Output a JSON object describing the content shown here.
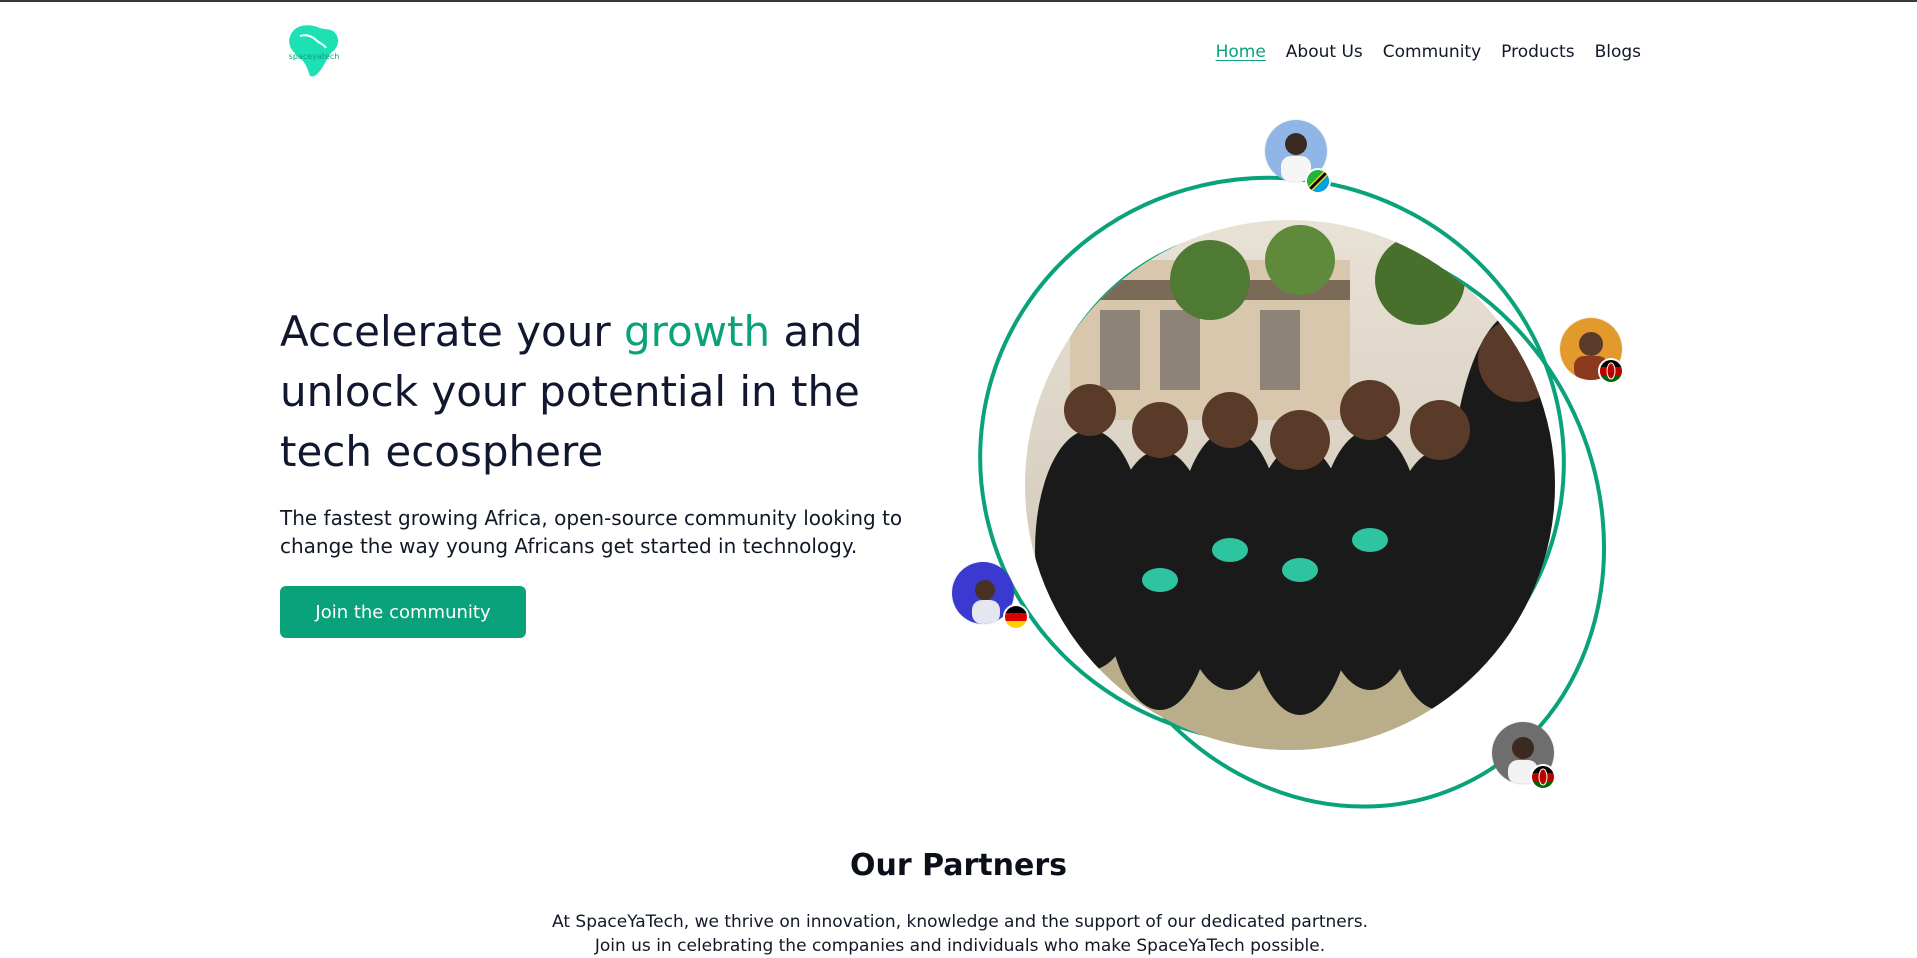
{
  "nav": {
    "items": [
      "Home",
      "About Us",
      "Community",
      "Products",
      "Blogs"
    ],
    "active": "Home"
  },
  "hero": {
    "title_part1": "Accelerate your ",
    "title_accent": "growth",
    "title_part2": " and unlock your potential in the tech ecosphere",
    "subtitle": "The fastest growing Africa, open-source community looking to change the way young Africans get started in technology.",
    "cta_label": "Join the community"
  },
  "partners": {
    "title": "Our Partners",
    "text": "At SpaceYaTech, we thrive on innovation, knowledge and the support of our dedicated partners. Join us in celebrating the companies and individuals who make SpaceYaTech possible."
  },
  "brand": {
    "logo_text": "spaceyatech",
    "accent_color": "#0aa27a",
    "logo_color": "#1ee0b5"
  },
  "icons": [
    "africa-logo-icon",
    "tanzania-flag-icon",
    "kenya-flag-icon",
    "germany-flag-icon"
  ]
}
